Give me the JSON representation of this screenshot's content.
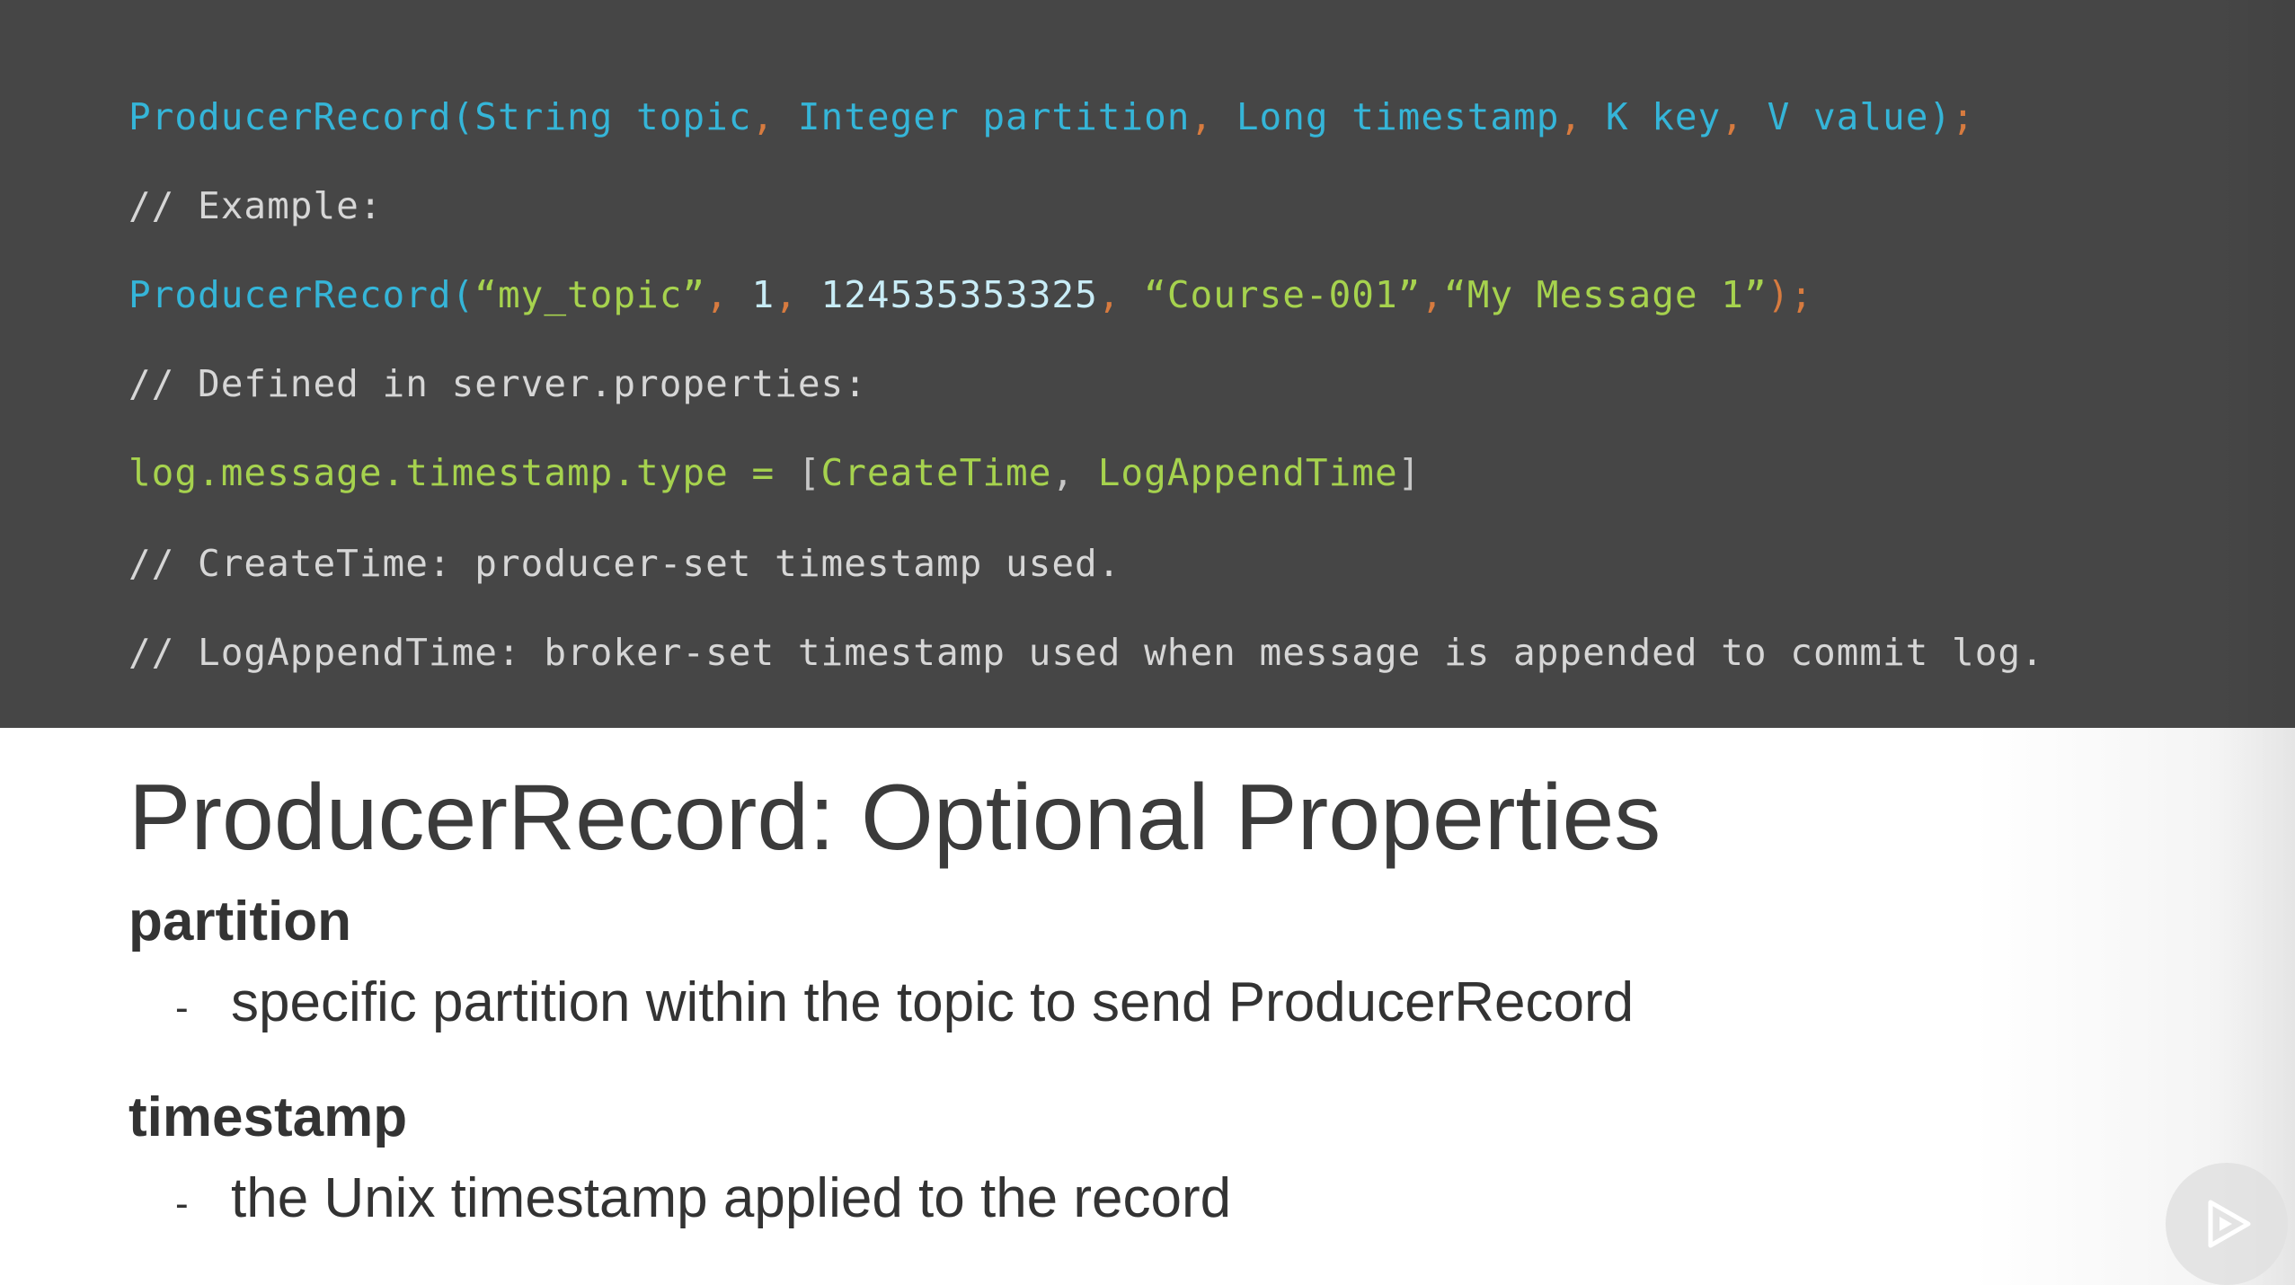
{
  "code": {
    "line1": {
      "p1": "ProducerRecord(String topic",
      "p2": ",",
      "p3": " Integer partition",
      "p4": ",",
      "p5": " Long timestamp",
      "p6": ",",
      "p7": " K key",
      "p8": ",",
      "p9": " V value)",
      "p10": ";"
    },
    "line2": "// Example:",
    "line3": {
      "p1": "ProducerRecord(",
      "p2": "“my_topic”",
      "p3": ",",
      "p4": " 1",
      "p5": ",",
      "p6": " 124535353325",
      "p7": ",",
      "p8": " “Course-001”",
      "p9": ",",
      "p10": "“My Message 1”",
      "p11": ");"
    },
    "line4": "// Defined in server.properties:",
    "line5": {
      "p1": "log.message.timestamp.type = ",
      "p2": "[",
      "p3": "CreateTime",
      "p4": ", ",
      "p5": "LogAppendTime",
      "p6": "]"
    },
    "line6": "// CreateTime: producer-set timestamp used.",
    "line7": "// LogAppendTime: broker-set timestamp used when message is appended to commit log."
  },
  "slide": {
    "title": "ProducerRecord: Optional Properties",
    "items": [
      {
        "term": "partition",
        "dash": "-",
        "description": "specific partition within the topic to send ProducerRecord"
      },
      {
        "term": "timestamp",
        "dash": "-",
        "description": "the Unix timestamp applied to the record"
      }
    ]
  },
  "player": {
    "play_icon": "play-icon"
  },
  "colors": {
    "code_background": "#464646",
    "code_blue": "#35b5d8",
    "code_orange": "#d77b3f",
    "code_green": "#a6d24e",
    "code_comment": "#d6d6d6"
  }
}
